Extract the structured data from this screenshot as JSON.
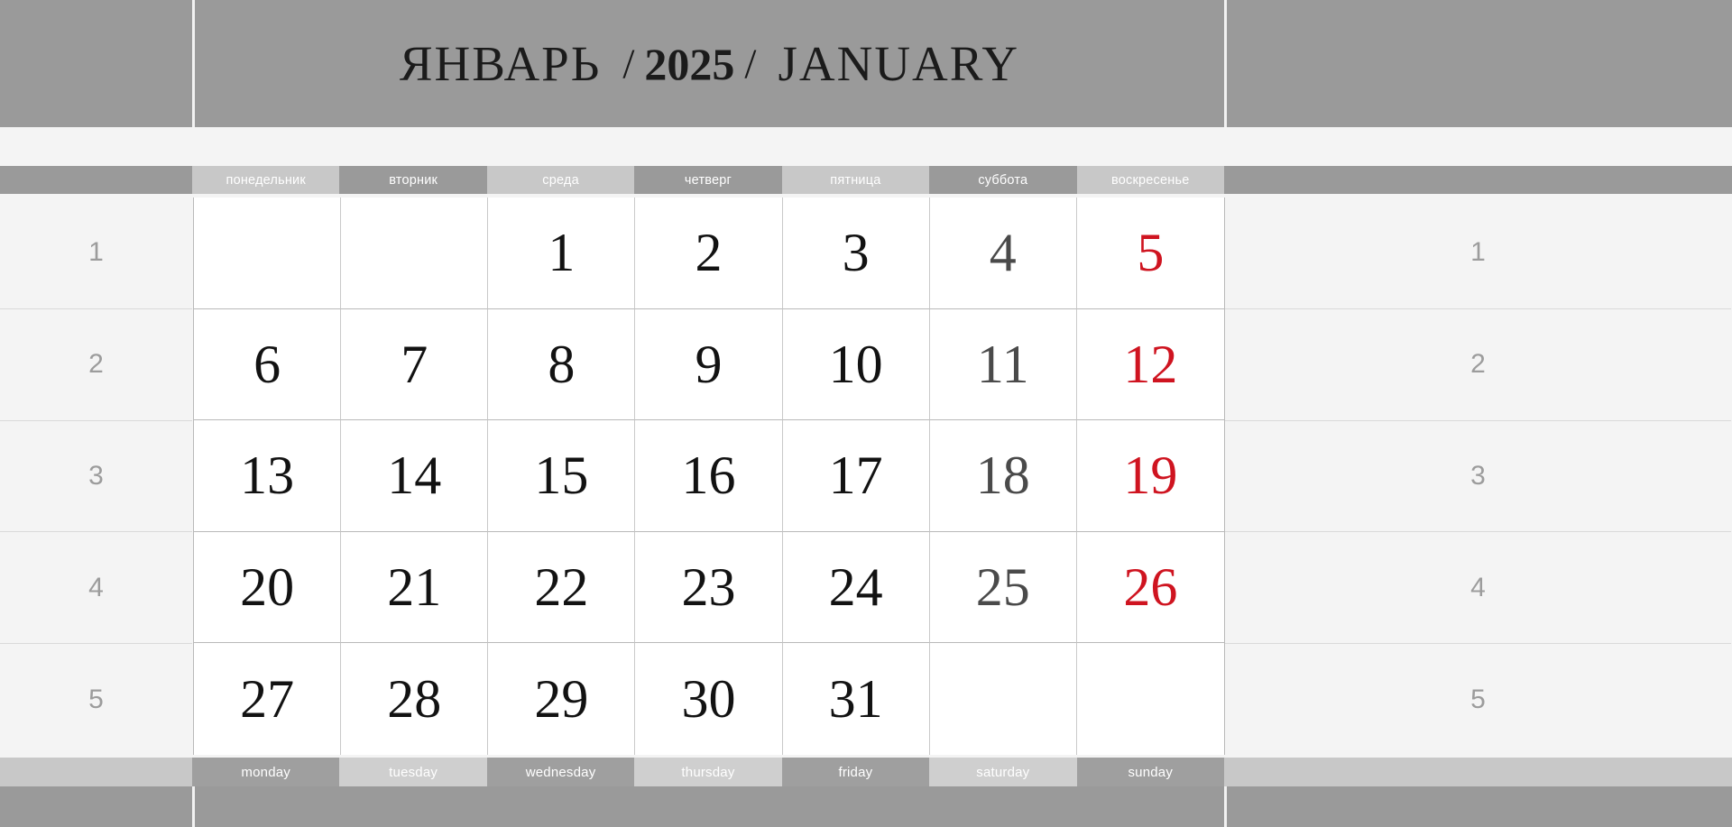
{
  "header": {
    "month_ru": "ЯНВАРЬ",
    "slash_left": "/",
    "year": "2025",
    "slash_right": "/",
    "month_en": "JANUARY"
  },
  "colors": {
    "band": "#9a9a9a",
    "header_light": "#c8c8c8",
    "header_dark": "#9a9a9a",
    "weeknum_bg": "#f4f4f4",
    "weekday_text": "#121212",
    "saturday_text": "#4a4a4a",
    "sunday_text": "#cf1420",
    "weeknum_text": "#9c9c9c"
  },
  "weekdays_ru": [
    "понедельник",
    "вторник",
    "среда",
    "четверг",
    "пятница",
    "суббота",
    "воскресенье"
  ],
  "weekdays_en": [
    "monday",
    "tuesday",
    "wednesday",
    "thursday",
    "friday",
    "saturday",
    "sunday"
  ],
  "week_numbers": [
    "1",
    "2",
    "3",
    "4",
    "5"
  ],
  "weeks": [
    {
      "days": [
        "",
        "",
        "1",
        "2",
        "3",
        "4",
        "5"
      ]
    },
    {
      "days": [
        "6",
        "7",
        "8",
        "9",
        "10",
        "11",
        "12"
      ]
    },
    {
      "days": [
        "13",
        "14",
        "15",
        "16",
        "17",
        "18",
        "19"
      ]
    },
    {
      "days": [
        "20",
        "21",
        "22",
        "23",
        "24",
        "25",
        "26"
      ]
    },
    {
      "days": [
        "27",
        "28",
        "29",
        "30",
        "31",
        "",
        ""
      ]
    }
  ]
}
